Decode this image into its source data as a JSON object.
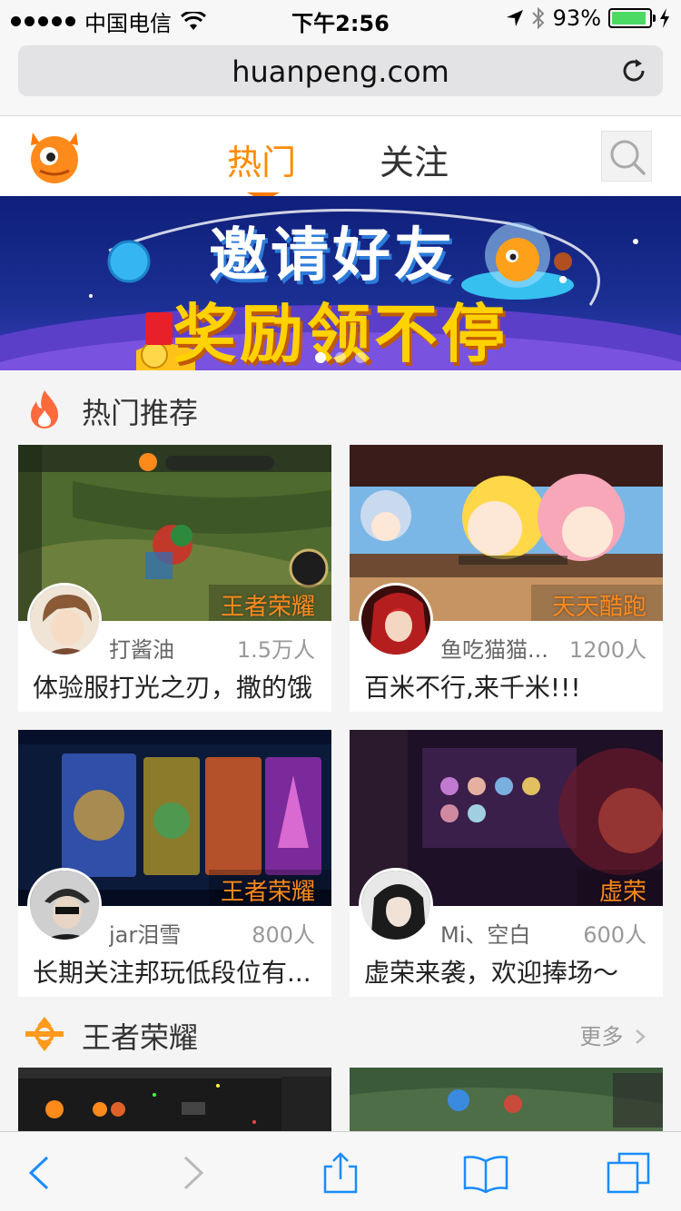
{
  "status_bar": {
    "carrier": "中国电信",
    "time": "下午2:56",
    "battery_percent": "93%",
    "battery_level": 0.93
  },
  "browser": {
    "url": "huanpeng.com"
  },
  "nav": {
    "tabs": [
      {
        "label": "热门",
        "active": true
      },
      {
        "label": "关注",
        "active": false
      }
    ]
  },
  "banner": {
    "line1": "邀请好友",
    "line2": "奖励领不停",
    "slide_count": 3,
    "active_slide": 1
  },
  "hot_section": {
    "title": "热门推荐",
    "cards": [
      {
        "game_tag": "王者荣耀",
        "nickname": "打酱油",
        "viewers": "1.5万人",
        "title": "体验服打光之刃，撒的饿"
      },
      {
        "game_tag": "天天酷跑",
        "nickname": "鱼吃猫猫...",
        "viewers": "1200人",
        "title": "百米不行,来千米!!!"
      },
      {
        "game_tag": "王者荣耀",
        "nickname": "jar泪雪",
        "viewers": "800人",
        "title": "长期关注邦玩低段位有..."
      },
      {
        "game_tag": "虚荣",
        "nickname": "Mi、空白",
        "viewers": "600人",
        "title": "虚荣来袭，欢迎捧场～"
      }
    ]
  },
  "game_section": {
    "title": "王者荣耀",
    "more_label": "更多"
  },
  "colors": {
    "accent": "#ff8a00",
    "background": "#f4f4f4",
    "ios_blue": "#1a8cff"
  }
}
